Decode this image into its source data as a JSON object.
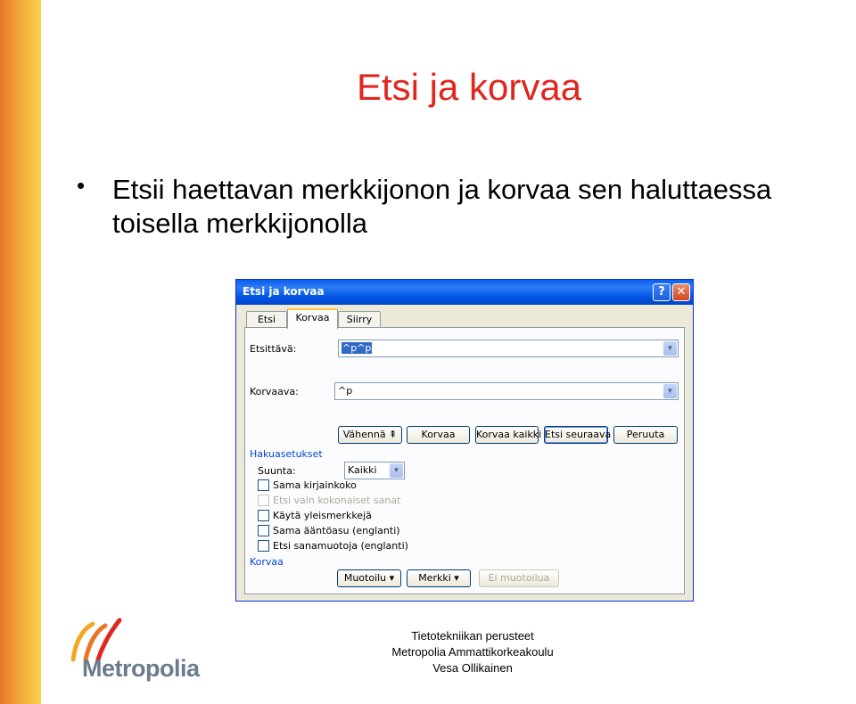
{
  "slide": {
    "title": "Etsi ja korvaa",
    "bullet": "Etsii haettavan merkkijonon ja korvaa sen haluttaessa toisella merkkijonolla"
  },
  "dialog": {
    "title": "Etsi ja korvaa",
    "help": "?",
    "close": "✕",
    "tabs": [
      "Etsi",
      "Korvaa",
      "Siirry"
    ],
    "active_tab": "Korvaa",
    "find_label": "Etsittävä:",
    "find_value": "^p^p",
    "replace_label": "Korvaava:",
    "replace_value": "^p",
    "buttons": {
      "less": "Vähennä ⇞",
      "replace": "Korvaa",
      "replace_all": "Korvaa kaikki",
      "find_next": "Etsi seuraava",
      "cancel": "Peruuta"
    },
    "search_options_label": "Hakuasetukset",
    "direction_label": "Suunta:",
    "direction_value": "Kaikki",
    "options": [
      {
        "label": "Sama kirjainkoko",
        "checked": false,
        "enabled": true
      },
      {
        "label": "Etsi vain kokonaiset sanat",
        "checked": false,
        "enabled": false
      },
      {
        "label": "Käytä yleismerkkejä",
        "checked": false,
        "enabled": true
      },
      {
        "label": "Sama ääntöasu (englanti)",
        "checked": false,
        "enabled": true
      },
      {
        "label": "Etsi sanamuotoja (englanti)",
        "checked": false,
        "enabled": true
      }
    ],
    "replace_section_label": "Korvaa",
    "bottom_buttons": {
      "format": "Muotoilu ▾",
      "special": "Merkki ▾",
      "no_formatting": "Ei muotoilua"
    }
  },
  "footer": {
    "line1": "Tietotekniikan perusteet",
    "line2": "Metropolia Ammattikorkeakoulu",
    "line3": "Vesa Ollikainen"
  },
  "logo": {
    "text": "Metropolia"
  },
  "colors": {
    "title": "#e0261e",
    "xp_blue": "#0054e3",
    "accent_orange": "#f3a43a"
  }
}
